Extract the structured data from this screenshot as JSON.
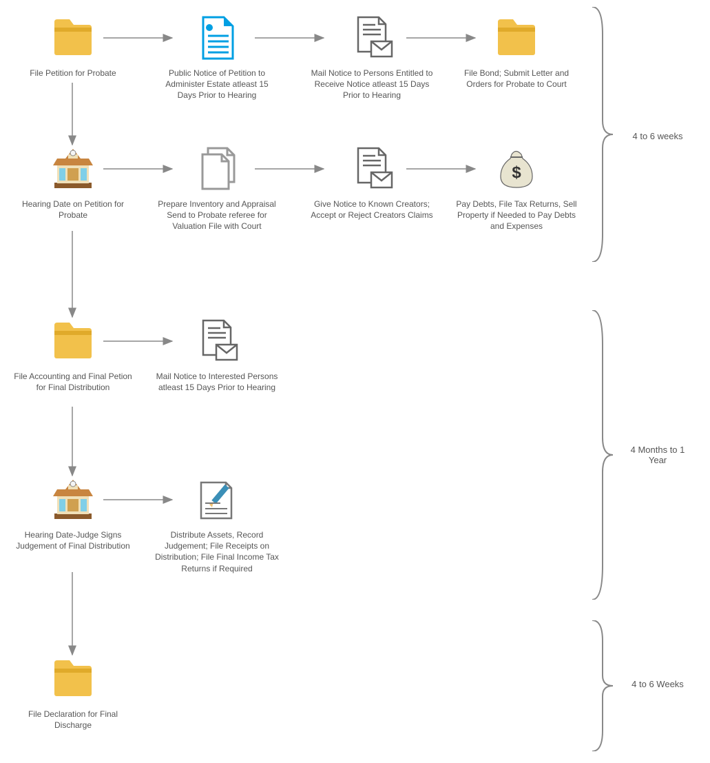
{
  "nodes": {
    "r1c1": "File Petition for Probate",
    "r1c2": "Public Notice of Petition to Administer Estate atleast 15 Days Prior to Hearing",
    "r1c3": "Mail Notice to Persons Entitled to Receive Notice atleast 15 Days Prior to Hearing",
    "r1c4": "File Bond; Submit Letter and Orders for Probate to Court",
    "r2c1": "Hearing Date on Petition for Probate",
    "r2c2": "Prepare Inventory and Appraisal Send to Probate referee for Valuation File with Court",
    "r2c3": "Give Notice to Known Creators; Accept or Reject Creators Claims",
    "r2c4": "Pay Debts, File Tax Returns, Sell Property if Needed to Pay Debts and Expenses",
    "r3c1": "File Accounting and Final Petion for Final Distribution",
    "r3c2": "Mail Notice to Interested Persons atleast 15 Days Prior to Hearing",
    "r4c1": "Hearing Date-Judge Signs Judgement of Final Distribution",
    "r4c2": "Distribute Assets, Record Judgement; File Receipts on Distribution; File Final Income Tax Returns if Required",
    "r5c1": "File Declaration for Final Discharge"
  },
  "times": {
    "t1": "4 to 6 weeks",
    "t2": "4 Months to 1 Year",
    "t3": "4 to 6 Weeks"
  }
}
